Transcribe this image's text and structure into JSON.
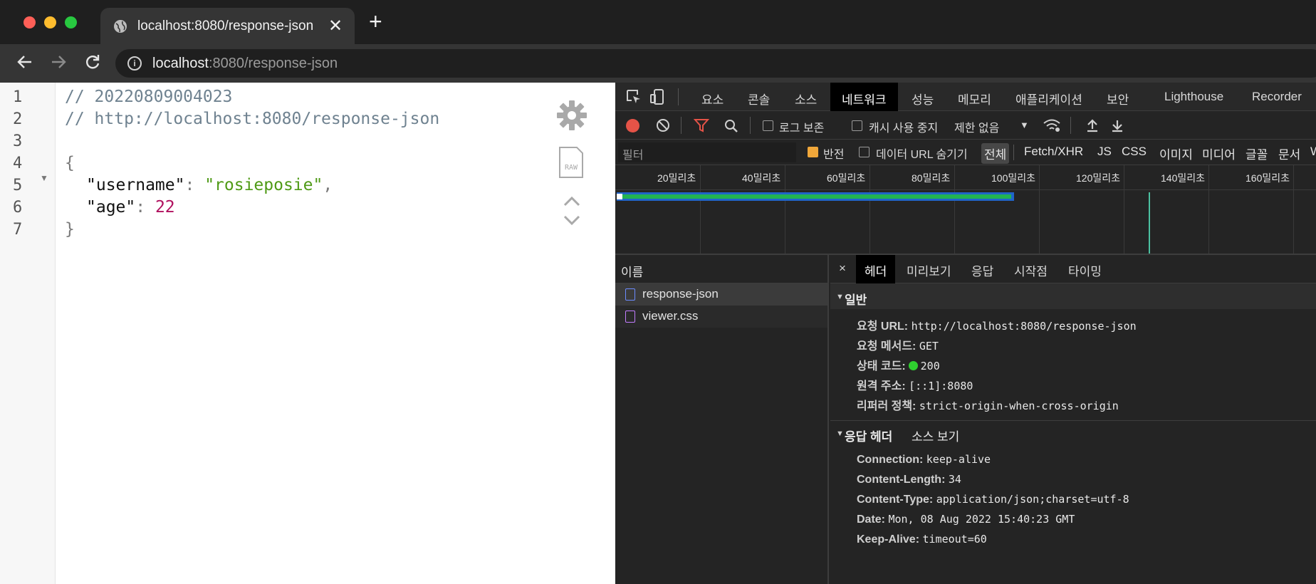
{
  "browser": {
    "tab_title": "localhost:8080/response-json",
    "tab_close": "✕",
    "new_tab": "+",
    "url_host": "localhost",
    "url_rest": ":8080/response-json"
  },
  "viewer": {
    "line_numbers": [
      "1",
      "2",
      "3",
      "4",
      "5",
      "6",
      "7"
    ],
    "comment_date": "// 20220809004023",
    "comment_url": "// http://localhost:8080/response-json",
    "open_brace": "{",
    "close_brace": "}",
    "key_username": "\"username\"",
    "value_username": "\"rosieposie\"",
    "key_age": "\"age\"",
    "value_age": "22"
  },
  "devtools": {
    "tabs": [
      "요소",
      "콘솔",
      "소스",
      "네트워크",
      "성능",
      "메모리",
      "애플리케이션",
      "보안",
      "Lighthouse",
      "Recorder"
    ],
    "active_tab": "네트워크",
    "preserve_log": "로그 보존",
    "disable_cache": "캐시 사용 중지",
    "throttling": "제한 없음",
    "filter_placeholder": "필터",
    "invert": "반전",
    "hide_data_urls": "데이터 URL 숨기기",
    "type_filters": [
      "전체",
      "Fetch/XHR",
      "JS",
      "CSS",
      "이미지",
      "미디어",
      "글꼴",
      "문서",
      "W"
    ],
    "timeline_ticks": [
      "20밀리초",
      "40밀리초",
      "60밀리초",
      "80밀리초",
      "100밀리초",
      "120밀리초",
      "140밀리초",
      "160밀리초"
    ],
    "name_header": "이름",
    "requests": [
      "response-json",
      "viewer.css"
    ],
    "detail_close": "×",
    "detail_tabs": [
      "헤더",
      "미리보기",
      "응답",
      "시작점",
      "타이밍"
    ],
    "general": {
      "title": "일반",
      "rows": [
        {
          "k": "요청 URL:",
          "v": "http://localhost:8080/response-json"
        },
        {
          "k": "요청 메서드:",
          "v": "GET"
        },
        {
          "k": "상태 코드:",
          "v": "200"
        },
        {
          "k": "원격 주소:",
          "v": "[::1]:8080"
        },
        {
          "k": "리퍼러 정책:",
          "v": "strict-origin-when-cross-origin"
        }
      ]
    },
    "response_headers": {
      "title": "응답 헤더",
      "view_source": "소스 보기",
      "rows": [
        {
          "k": "Connection:",
          "v": "keep-alive"
        },
        {
          "k": "Content-Length:",
          "v": "34"
        },
        {
          "k": "Content-Type:",
          "v": "application/json;charset=utf-8"
        },
        {
          "k": "Date:",
          "v": "Mon, 08 Aug 2022 15:40:23 GMT"
        },
        {
          "k": "Keep-Alive:",
          "v": "timeout=60"
        }
      ]
    }
  },
  "colors": {
    "record": "#e55347",
    "status_ok": "#2fd02f",
    "json_string": "#4f9a16",
    "json_number": "#b0105e"
  }
}
